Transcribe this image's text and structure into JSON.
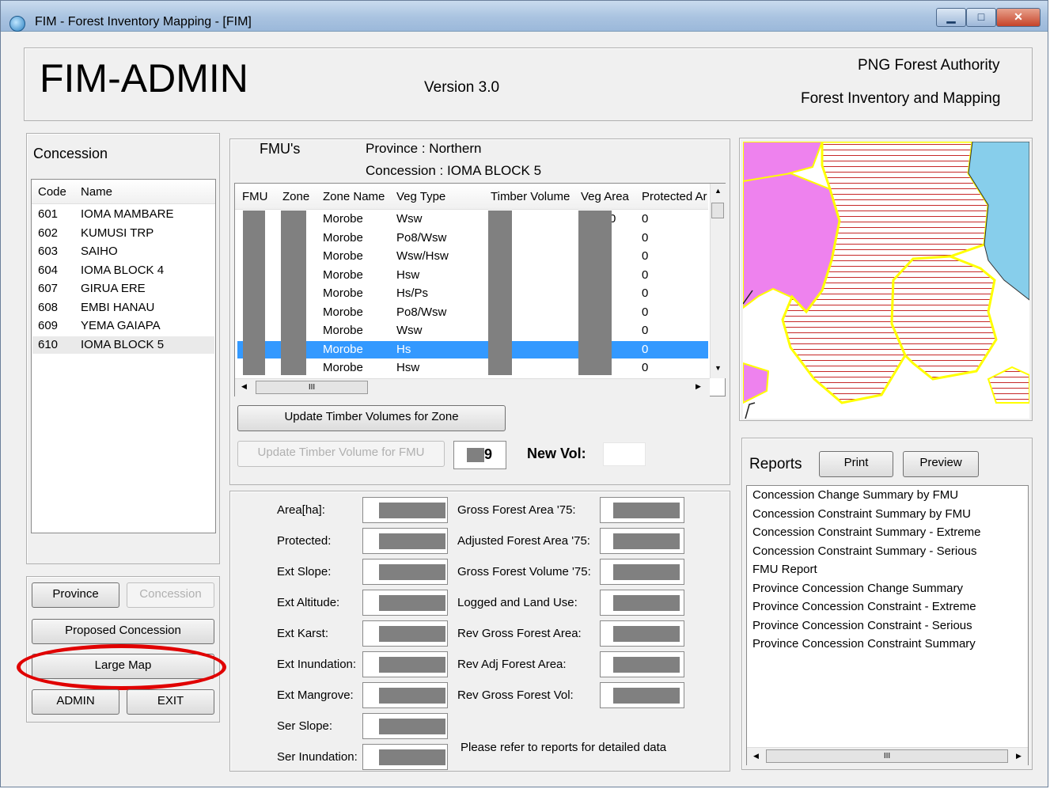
{
  "window": {
    "title": "FIM - Forest Inventory Mapping - [FIM]",
    "minimize": "▁",
    "maximize": "□",
    "close": "✕"
  },
  "header": {
    "app_name": "FIM-ADMIN",
    "version": "Version 3.0",
    "org_line1": "PNG Forest Authority",
    "org_line2": "Forest Inventory and Mapping"
  },
  "concession": {
    "heading": "Concession",
    "columns": [
      "Code",
      "Name"
    ],
    "rows": [
      {
        "code": "601",
        "name": "IOMA MAMBARE"
      },
      {
        "code": "602",
        "name": "KUMUSI TRP"
      },
      {
        "code": "603",
        "name": "SAIHO"
      },
      {
        "code": "604",
        "name": "IOMA BLOCK 4"
      },
      {
        "code": "607",
        "name": "GIRUA ERE"
      },
      {
        "code": "608",
        "name": "EMBI HANAU"
      },
      {
        "code": "609",
        "name": "YEMA GAIAPA"
      },
      {
        "code": "610",
        "name": "IOMA BLOCK 5"
      }
    ],
    "selected_index": 7
  },
  "nav_buttons": {
    "province": "Province",
    "concession": "Concession",
    "proposed": "Proposed Concession",
    "large_map": "Large Map",
    "admin": "ADMIN",
    "exit": "EXIT"
  },
  "fmu": {
    "heading": "FMU's",
    "province": "Province : Northern",
    "concession": "Concession : IOMA BLOCK 5",
    "columns": [
      "FMU",
      "Zone",
      "Zone Name",
      "Veg Type",
      "Timber Volume",
      "Veg Area",
      "Protected Ar"
    ],
    "rows": [
      {
        "zone_name": "Morobe",
        "veg_type": "Wsw",
        "veg_area": "0",
        "protected": "0"
      },
      {
        "zone_name": "Morobe",
        "veg_type": "Po8/Wsw",
        "veg_area": "",
        "protected": "0"
      },
      {
        "zone_name": "Morobe",
        "veg_type": "Wsw/Hsw",
        "veg_area": "",
        "protected": "0"
      },
      {
        "zone_name": "Morobe",
        "veg_type": "Hsw",
        "veg_area": "",
        "protected": "0"
      },
      {
        "zone_name": "Morobe",
        "veg_type": "Hs/Ps",
        "veg_area": "",
        "protected": "0"
      },
      {
        "zone_name": "Morobe",
        "veg_type": "Po8/Wsw",
        "veg_area": "",
        "protected": "0"
      },
      {
        "zone_name": "Morobe",
        "veg_type": "Wsw",
        "veg_area": "",
        "protected": "0"
      },
      {
        "zone_name": "Morobe",
        "veg_type": "Hs",
        "veg_area": "",
        "protected": "0"
      },
      {
        "zone_name": "Morobe",
        "veg_type": "Hsw",
        "veg_area": "",
        "protected": "0"
      }
    ],
    "selected_index": 7,
    "hscroll_thumb": "III",
    "update_zone_button": "Update Timber Volumes for Zone",
    "update_fmu_button": "Update Timber Volume for FMU",
    "fmu_number_value": "9",
    "new_vol_label": "New Vol:"
  },
  "stats": {
    "left": [
      "Area[ha]:",
      "Protected:",
      "Ext Slope:",
      "Ext Altitude:",
      "Ext Karst:",
      "Ext Inundation:",
      "Ext Mangrove:",
      "Ser Slope:",
      "Ser Inundation:"
    ],
    "right": [
      "Gross Forest Area '75:",
      "Adjusted Forest Area '75:",
      "Gross Forest Volume '75:",
      "Logged and Land Use:",
      "Rev Gross Forest Area:",
      "Rev Adj Forest Area:",
      "Rev Gross Forest Vol:"
    ],
    "note": "Please refer to reports for detailed data"
  },
  "map": {
    "colors": {
      "water": "#87ceeb",
      "land": "#ee82ee",
      "boundary": "#ffff00",
      "hatch": "#c62828"
    }
  },
  "reports": {
    "heading": "Reports",
    "print": "Print",
    "preview": "Preview",
    "items": [
      "Concession Change Summary by FMU",
      "Concession Constraint  Summary by FMU",
      "Concession Constraint Summary  - Extreme",
      "Concession Constraint Summary  - Serious",
      "FMU Report",
      "Province Concession Change Summary",
      "Province Concession Constraint  - Extreme",
      "Province Concession Constraint  - Serious",
      "Province Concession Constraint   Summary"
    ],
    "hscroll_thumb": "III"
  },
  "colors": {
    "selection": "#3399ff",
    "highlight_ring": "#e00000",
    "redaction": "#808080"
  }
}
